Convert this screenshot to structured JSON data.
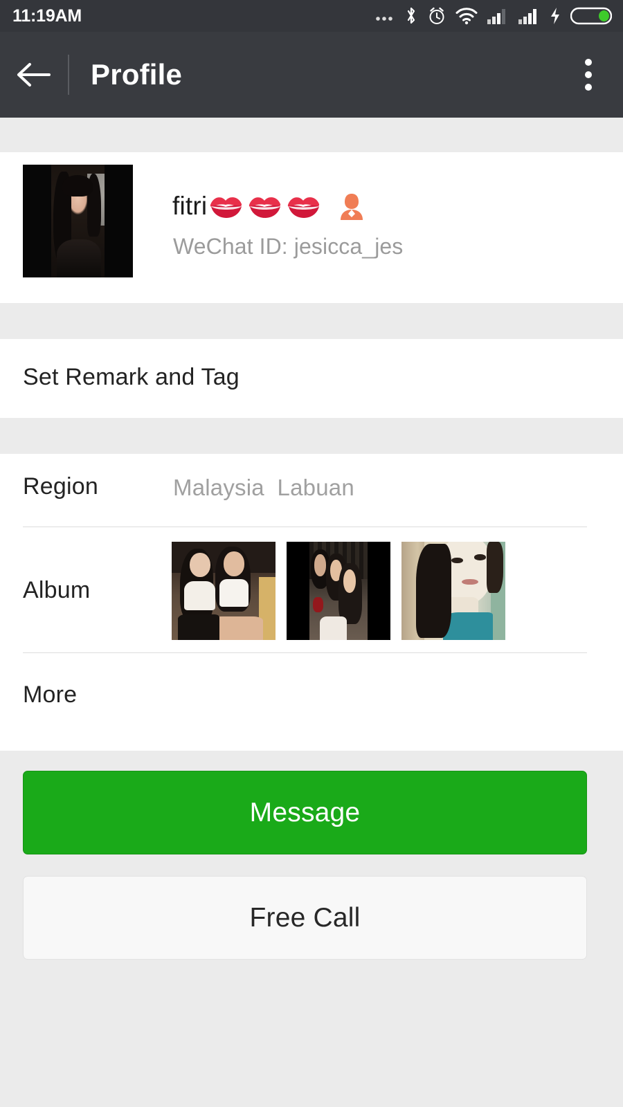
{
  "statusbar": {
    "time": "11:19AM",
    "icons": [
      "more-dots-icon",
      "bluetooth-icon",
      "alarm-clock-icon",
      "wifi-icon",
      "signal-sim1-icon",
      "signal-sim2-icon",
      "charging-bolt-icon",
      "battery-icon"
    ],
    "background": "#34363b",
    "battery_fill_color": "#3ecb2b"
  },
  "appbar": {
    "back_icon": "arrow-left-icon",
    "title": "Profile",
    "overflow_icon": "more-vertical-icon",
    "background": "#393b40"
  },
  "profile": {
    "avatar_alt": "profile-photo",
    "name": "fitri",
    "name_emojis": [
      "kiss-mark-emoji",
      "kiss-mark-emoji",
      "kiss-mark-emoji",
      "person-silhouette-emoji"
    ],
    "wechat_id_label": "WeChat ID: jesicca_jes"
  },
  "remark": {
    "label": "Set Remark and Tag"
  },
  "info": {
    "region_label": "Region",
    "region_value": "Malaysia  Labuan",
    "album_label": "Album",
    "album_thumbs": [
      "album-thumb-1",
      "album-thumb-2",
      "album-thumb-3"
    ],
    "more_label": "More"
  },
  "actions": {
    "message_label": "Message",
    "message_color": "#1aaa19",
    "free_call_label": "Free Call",
    "free_call_color": "#f8f8f8"
  }
}
